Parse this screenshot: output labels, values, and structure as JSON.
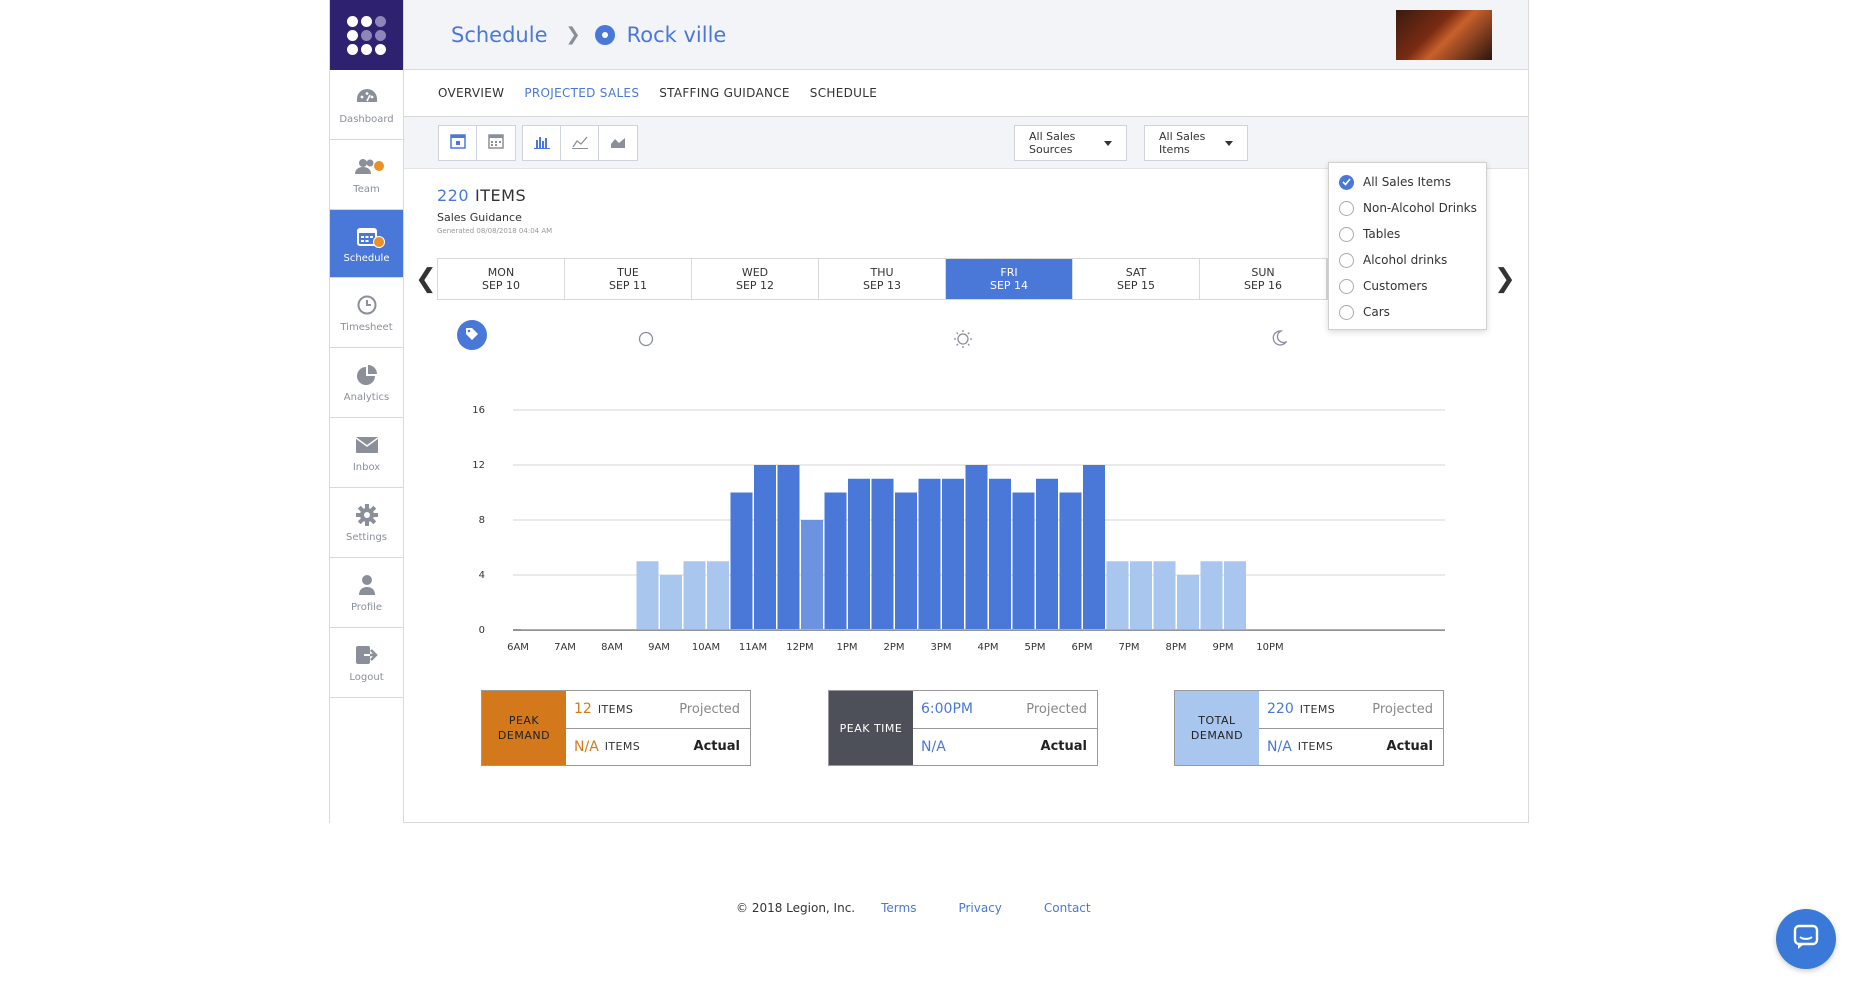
{
  "header": {
    "breadcrumb_root": "Schedule",
    "location": "Rock ville"
  },
  "sidebar": {
    "items": [
      {
        "label": "Dashboard",
        "icon": "dashboard-icon"
      },
      {
        "label": "Team",
        "icon": "team-icon"
      },
      {
        "label": "Schedule",
        "icon": "schedule-icon",
        "active": true
      },
      {
        "label": "Timesheet",
        "icon": "clock-icon"
      },
      {
        "label": "Analytics",
        "icon": "pie-chart-icon"
      },
      {
        "label": "Inbox",
        "icon": "envelope-icon"
      },
      {
        "label": "Settings",
        "icon": "gear-icon"
      },
      {
        "label": "Profile",
        "icon": "user-icon"
      },
      {
        "label": "Logout",
        "icon": "logout-icon"
      }
    ]
  },
  "tabs": [
    "OVERVIEW",
    "PROJECTED SALES",
    "STAFFING GUIDANCE",
    "SCHEDULE"
  ],
  "active_tab": "PROJECTED SALES",
  "toolbar": {
    "sales_sources": "All Sales Sources",
    "sales_items": "All Sales Items"
  },
  "dropdown": {
    "options": [
      "All Sales Items",
      "Non-Alcohol Drinks",
      "Tables",
      "Alcohol drinks",
      "Customers",
      "Cars"
    ],
    "selected": "All Sales Items"
  },
  "summary": {
    "count": "220",
    "unit": "ITEMS",
    "title": "Sales Guidance",
    "generated": "Generated 08/08/2018 04:04 AM"
  },
  "days": [
    {
      "dow": "MON",
      "date": "SEP 10"
    },
    {
      "dow": "TUE",
      "date": "SEP 11"
    },
    {
      "dow": "WED",
      "date": "SEP 12"
    },
    {
      "dow": "THU",
      "date": "SEP 13"
    },
    {
      "dow": "FRI",
      "date": "SEP 14",
      "active": true
    },
    {
      "dow": "SAT",
      "date": "SEP 15"
    },
    {
      "dow": "SUN",
      "date": "SEP 16"
    }
  ],
  "chart_data": {
    "type": "bar",
    "ylim": [
      0,
      16
    ],
    "yticks": [
      0,
      4,
      8,
      12,
      16
    ],
    "xticks": [
      "6AM",
      "7AM",
      "8AM",
      "9AM",
      "10AM",
      "11AM",
      "12PM",
      "1PM",
      "2PM",
      "3PM",
      "4PM",
      "5PM",
      "6PM",
      "7PM",
      "8PM",
      "9PM",
      "10PM"
    ],
    "bars_per_hour": 2,
    "start_hour": 6,
    "values": [
      0,
      0,
      0,
      0,
      0,
      5,
      4,
      5,
      5,
      10,
      12,
      12,
      8,
      10,
      11,
      11,
      10,
      11,
      11,
      12,
      11,
      10,
      11,
      10,
      12,
      5,
      5,
      5,
      4,
      5,
      5,
      0,
      0
    ],
    "colors": {
      "peak": "#4a78d9",
      "mid": "#6b93e0",
      "low": "#a9c6ef"
    },
    "grid": true
  },
  "stats": {
    "peak_demand": {
      "label_l1": "PEAK",
      "label_l2": "DEMAND",
      "projected_value": "12",
      "actual_value": "N/A",
      "unit": "ITEMS",
      "projected": "Projected",
      "actual": "Actual"
    },
    "peak_time": {
      "label": "PEAK TIME",
      "projected_value": "6:00PM",
      "actual_value": "N/A",
      "projected": "Projected",
      "actual": "Actual"
    },
    "total_demand": {
      "label_l1": "TOTAL",
      "label_l2": "DEMAND",
      "projected_value": "220",
      "actual_value": "N/A",
      "unit": "ITEMS",
      "projected": "Projected",
      "actual": "Actual"
    }
  },
  "footer": {
    "copyright": "© 2018 Legion, Inc.",
    "links": [
      "Terms",
      "Privacy",
      "Contact"
    ]
  }
}
